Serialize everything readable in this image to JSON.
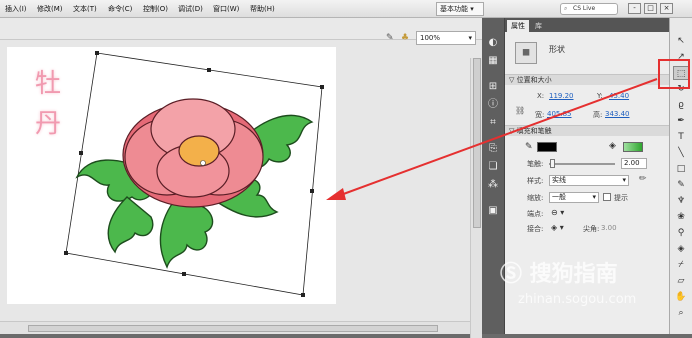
{
  "menu": {
    "items": [
      "插入(I)",
      "修改(M)",
      "文本(T)",
      "命令(C)",
      "控制(O)",
      "调试(D)",
      "窗口(W)",
      "帮助(H)"
    ],
    "workspace": "基本功能",
    "search_label": "CS Live"
  },
  "window": {
    "minimize": "-",
    "maximize": "□",
    "close": "×"
  },
  "stage": {
    "zoom": "100%",
    "title_chars": [
      "牡",
      "丹"
    ]
  },
  "panel": {
    "tabs": [
      "属性",
      "库"
    ],
    "object_type": "形状",
    "section_position": "位置和大小",
    "x_label": "X:",
    "x_value": "119.20",
    "y_label": "Y:",
    "y_value": "45.40",
    "w_label": "宽:",
    "w_value": "405.85",
    "h_label": "高:",
    "h_value": "343.40",
    "section_fill": "填充和笔触",
    "stroke_label": "笔触:",
    "stroke_value": "2.00",
    "style_label": "样式:",
    "style_value": "实线",
    "scale_label": "缩放:",
    "scale_value": "一般",
    "hint_label": "提示",
    "cap_label": "端点:",
    "join_label": "接合:",
    "miter_label": "尖角:",
    "miter_value": "3.00"
  },
  "colors": {
    "stroke": "#000000",
    "fill": "#3dba3d",
    "highlight": "#e53030"
  },
  "watermark": {
    "brand": "搜狗指南",
    "url": "zhinan.sogou.com"
  }
}
